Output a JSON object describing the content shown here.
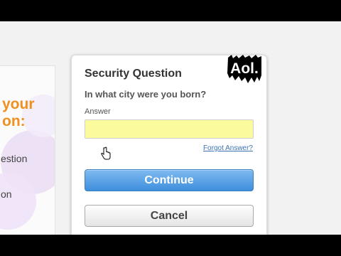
{
  "background_panel": {
    "heading": "your\non:",
    "line1": "estion",
    "line2": "on"
  },
  "dialog": {
    "title": "Security Question",
    "question": "In what city were you born?",
    "answer_label": "Answer",
    "answer_value": "",
    "forgot_link": "Forgot Answer?",
    "continue_label": "Continue",
    "cancel_label": "Cancel",
    "logo_text": "Aol."
  },
  "colors": {
    "accent_orange": "#f0901e",
    "primary_button": "#3e8fdc",
    "input_highlight": "#fbfb9e",
    "link": "#3b73b6"
  }
}
